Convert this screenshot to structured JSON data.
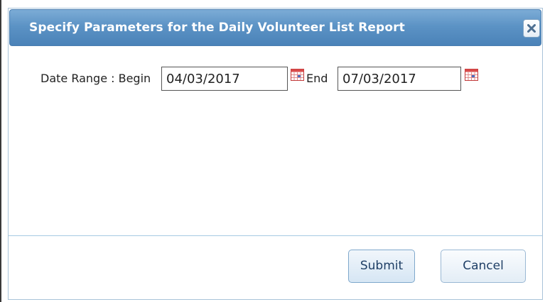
{
  "dialog": {
    "title": "Specify Parameters for the Daily Volunteer List Report",
    "close_icon": "close-icon"
  },
  "date_range": {
    "label": "Date Range : Begin",
    "begin_value": "04/03/2017",
    "end_label": "End",
    "end_value": "07/03/2017",
    "calendar_icon": "calendar-icon"
  },
  "buttons": {
    "submit_label": "Submit",
    "cancel_label": "Cancel"
  },
  "colors": {
    "titlebar": "#5c93c5",
    "title_text": "#ffffff",
    "button_text": "#1f3f66",
    "divider": "#a6c9e2"
  }
}
